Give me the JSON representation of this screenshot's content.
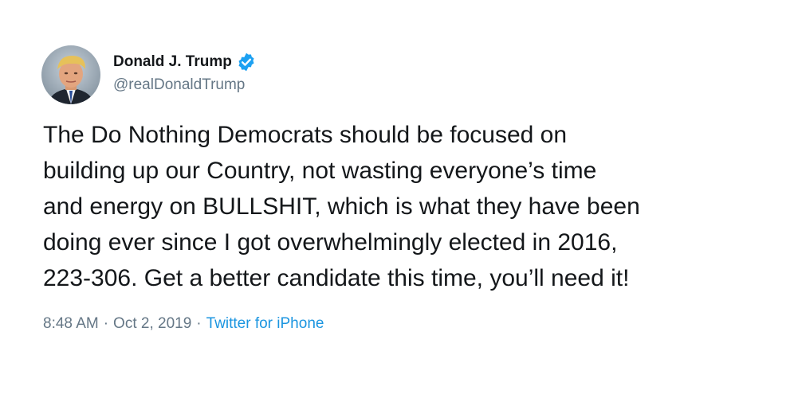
{
  "tweet": {
    "author": {
      "display_name": "Donald J. Trump",
      "handle": "@realDonaldTrump",
      "verified_icon": "verified-badge-icon",
      "avatar_icon": "profile-photo"
    },
    "text_lines": [
      "The Do Nothing Democrats should be focused on",
      "building up our Country, not wasting everyone’s time",
      "and energy on BULLSHIT, which is what they have been",
      "doing ever since I got overwhelmingly elected in 2016,",
      "223-306. Get a better candidate this time, you’ll need it!"
    ],
    "time": "8:48 AM",
    "separator": "·",
    "date": "Oct 2, 2019",
    "source": "Twitter for iPhone"
  },
  "colors": {
    "text": "#14171a",
    "secondary": "#657786",
    "link": "#1b95e0",
    "verified": "#1da1f2"
  }
}
